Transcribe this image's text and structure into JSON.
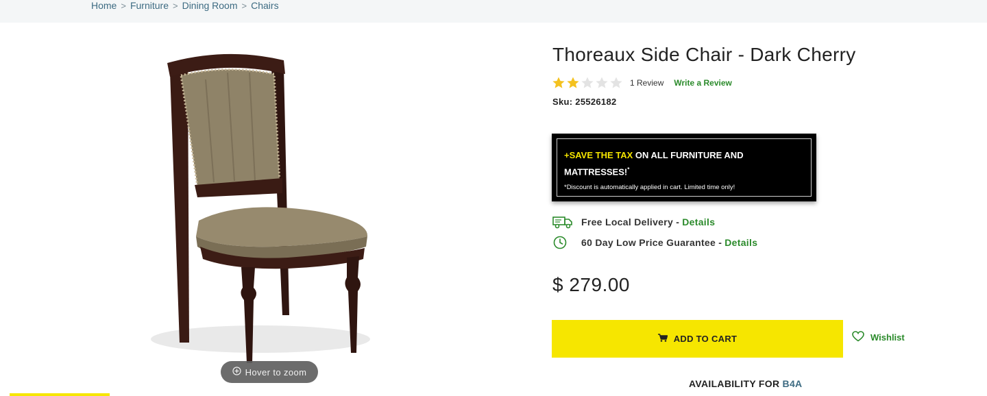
{
  "breadcrumb": {
    "items": [
      "Home",
      "Furniture",
      "Dining Room",
      "Chairs"
    ]
  },
  "gallery": {
    "zoom_hint": "Hover to zoom"
  },
  "product": {
    "title": "Thoreaux Side Chair - Dark Cherry",
    "rating": 2,
    "rating_max": 5,
    "review_count": "1 Review",
    "write_review": "Write a Review",
    "sku": "Sku: 25526182",
    "price": "$ 279.00"
  },
  "promo": {
    "highlight": "+SAVE THE TAX",
    "rest": " ON ALL FURNITURE AND",
    "line2": "MATTRESSES!",
    "sup": "*",
    "fine": "*Discount is automatically applied in cart. Limited time only!"
  },
  "features": [
    {
      "icon": "delivery-truck-icon",
      "text": "Free Local Delivery - ",
      "link": "Details"
    },
    {
      "icon": "clock-icon",
      "text": "60 Day Low Price Guarantee - ",
      "link": "Details"
    }
  ],
  "actions": {
    "add_to_cart": "ADD TO CART",
    "wishlist": "Wishlist"
  },
  "availability": {
    "label": "AVAILABILITY FOR ",
    "store": "B4A"
  },
  "colors": {
    "accent_yellow": "#f6e600",
    "link_green": "#2a8a2a",
    "star_filled": "#f4c21f",
    "star_empty": "#e3e3e3"
  }
}
